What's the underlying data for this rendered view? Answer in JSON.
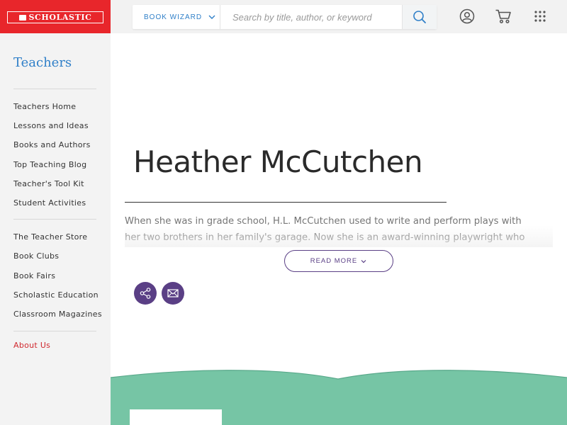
{
  "brand": {
    "logo_text": "SCHOLASTIC",
    "red": "#e8262b",
    "blue": "#2f7fc8",
    "purple": "#5a3f85",
    "green": "#76c5a5"
  },
  "header": {
    "book_wizard_label": "BOOK WIZARD",
    "search_placeholder": "Search by title, author, or keyword",
    "icons": [
      "chevron-down-icon",
      "search-icon",
      "account-icon",
      "cart-icon",
      "grid-menu-icon"
    ]
  },
  "sidebar": {
    "title": "Teachers",
    "group1": [
      "Teachers Home",
      "Lessons and Ideas",
      "Books and Authors",
      "Top Teaching Blog",
      "Teacher's Tool Kit",
      "Student Activities"
    ],
    "group2": [
      "The Teacher Store",
      "Book Clubs",
      "Book Fairs",
      "Scholastic Education",
      "Classroom Magazines"
    ],
    "group3": [
      "About Us"
    ]
  },
  "main": {
    "heading": "Heather McCutchen",
    "bio_line1": "When she was in grade school, H.L. McCutchen used to write and perform plays with",
    "bio_line2": "her two brothers in her family's garage. Now she is an award-winning playwright who",
    "read_more_label": "READ MORE",
    "share_icons": [
      "share-icon",
      "email-icon"
    ]
  }
}
